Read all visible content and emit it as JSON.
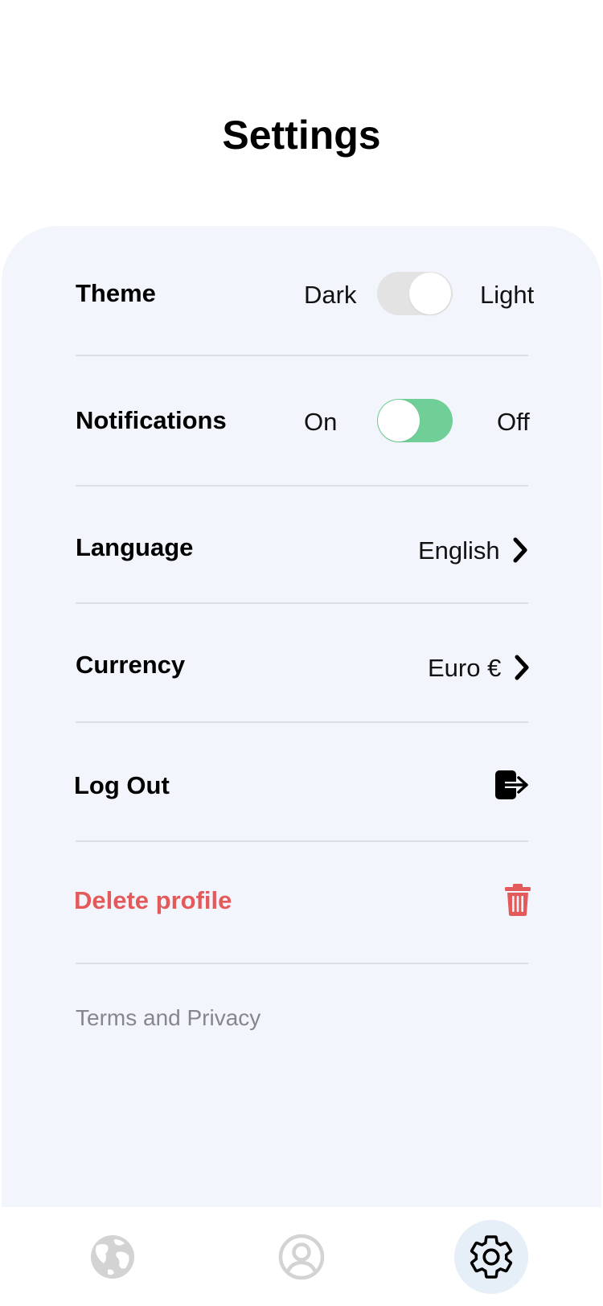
{
  "header": {
    "title": "Settings"
  },
  "settings": {
    "theme": {
      "label": "Theme",
      "left_option": "Dark",
      "right_option": "Light",
      "selected": "Light"
    },
    "notifications": {
      "label": "Notifications",
      "left_option": "On",
      "right_option": "Off",
      "selected": "On"
    },
    "language": {
      "label": "Language",
      "value": "English"
    },
    "currency": {
      "label": "Currency",
      "value": "Euro €"
    },
    "logout": {
      "label": "Log Out",
      "icon": "logout-icon"
    },
    "delete": {
      "label": "Delete profile",
      "icon": "trash-icon"
    },
    "terms": {
      "label": "Terms and Privacy"
    }
  },
  "tabbar": {
    "items": [
      {
        "icon": "globe-icon",
        "active": false
      },
      {
        "icon": "profile-icon",
        "active": false
      },
      {
        "icon": "gear-icon",
        "active": true
      }
    ]
  },
  "colors": {
    "panel_bg": "#f3f5fd",
    "toggle_off": "#e3e3e3",
    "toggle_on": "#6fcf97",
    "danger": "#e45a5a",
    "muted_text": "#85878c",
    "active_tab_bg": "#e6eef8",
    "inactive_icon": "#d3d3d3"
  }
}
